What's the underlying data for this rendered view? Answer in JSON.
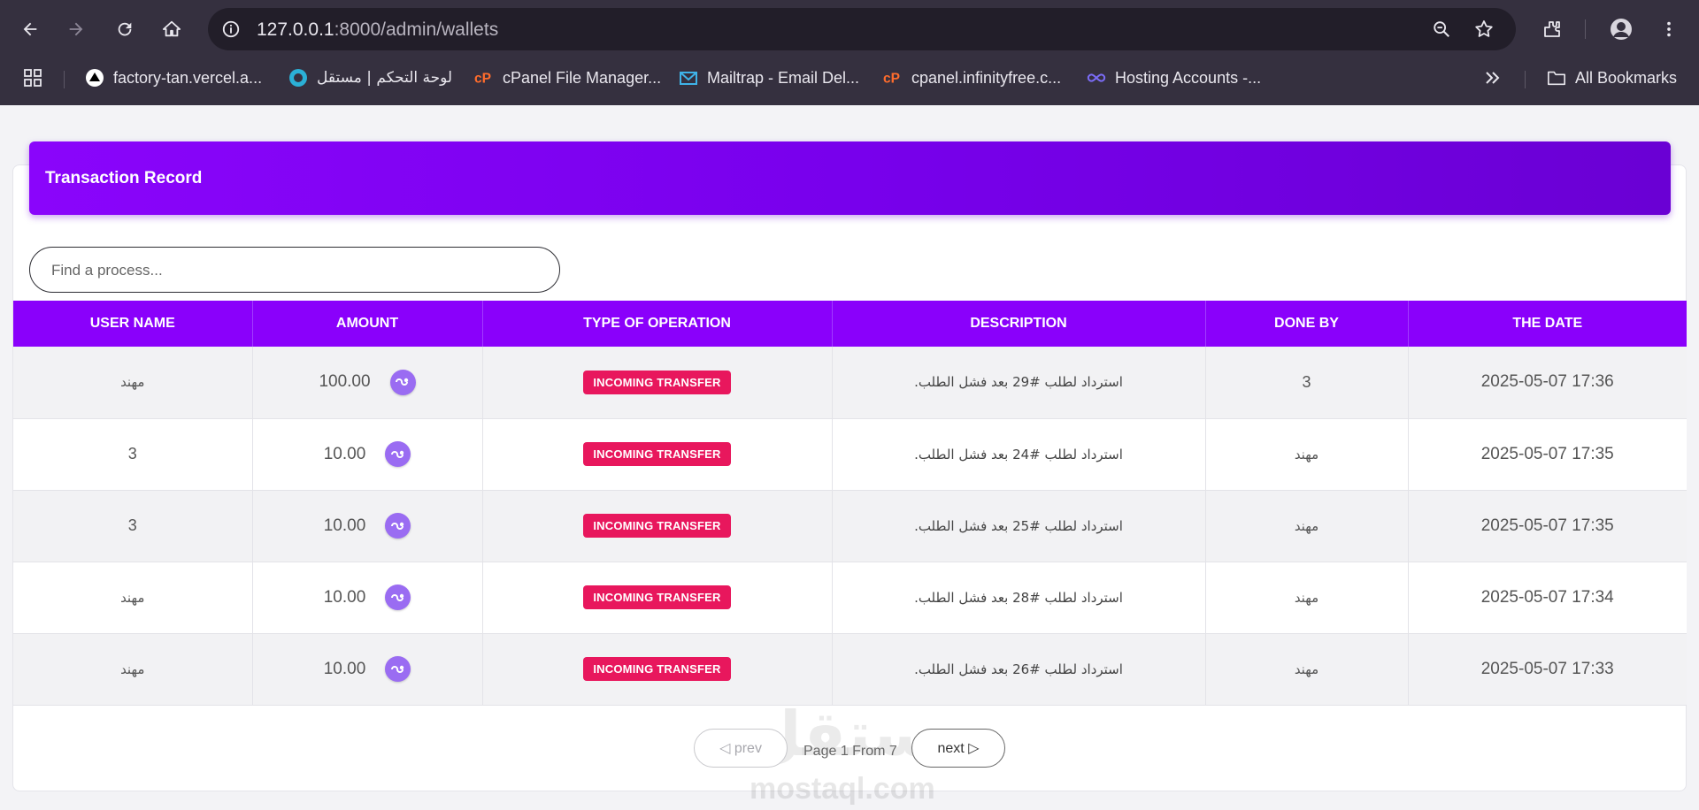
{
  "browser": {
    "url_host": "127.0.0.1",
    "url_rest": ":8000/admin/wallets",
    "bookmarks": [
      {
        "label": "factory-tan.vercel.a...",
        "icon": "vercel-icon"
      },
      {
        "label": "لوحة التحكم | مستقل",
        "icon": "mostaql-icon"
      },
      {
        "label": "cPanel File Manager...",
        "icon": "cpanel-icon"
      },
      {
        "label": "Mailtrap - Email Del...",
        "icon": "mailtrap-icon"
      },
      {
        "label": "cpanel.infinityfree.c...",
        "icon": "cpanel-icon"
      },
      {
        "label": "Hosting Accounts -...",
        "icon": "infinity-icon"
      }
    ],
    "all_bookmarks": "All Bookmarks"
  },
  "page": {
    "title": "Transaction Record",
    "search_placeholder": "Find a process..."
  },
  "table": {
    "columns": [
      "USER NAME",
      "AMOUNT",
      "TYPE OF OPERATION",
      "DESCRIPTION",
      "DONE BY",
      "THE DATE"
    ],
    "rows": [
      {
        "user": "مهند",
        "amount": "100.00",
        "type": "INCOMING TRANSFER",
        "description": "استرداد لطلب #29 بعد فشل الطلب.",
        "done_by": "3",
        "date": "2025-05-07 17:36"
      },
      {
        "user": "3",
        "amount": "10.00",
        "type": "INCOMING TRANSFER",
        "description": "استرداد لطلب #24 بعد فشل الطلب.",
        "done_by": "مهند",
        "date": "2025-05-07 17:35"
      },
      {
        "user": "3",
        "amount": "10.00",
        "type": "INCOMING TRANSFER",
        "description": "استرداد لطلب #25 بعد فشل الطلب.",
        "done_by": "مهند",
        "date": "2025-05-07 17:35"
      },
      {
        "user": "مهند",
        "amount": "10.00",
        "type": "INCOMING TRANSFER",
        "description": "استرداد لطلب #28 بعد فشل الطلب.",
        "done_by": "مهند",
        "date": "2025-05-07 17:34"
      },
      {
        "user": "مهند",
        "amount": "10.00",
        "type": "INCOMING TRANSFER",
        "description": "استرداد لطلب #26 بعد فشل الطلب.",
        "done_by": "مهند",
        "date": "2025-05-07 17:33"
      }
    ]
  },
  "pagination": {
    "prev_label": "◁ prev",
    "next_label": "next ▷",
    "info": "Page 1 From 7"
  },
  "watermark": {
    "arabic": "مستقل",
    "latin": "mostaql.com"
  },
  "colors": {
    "accent": "#8a00fb",
    "badge": "#e8175d",
    "coin": "#9a6cf2"
  }
}
